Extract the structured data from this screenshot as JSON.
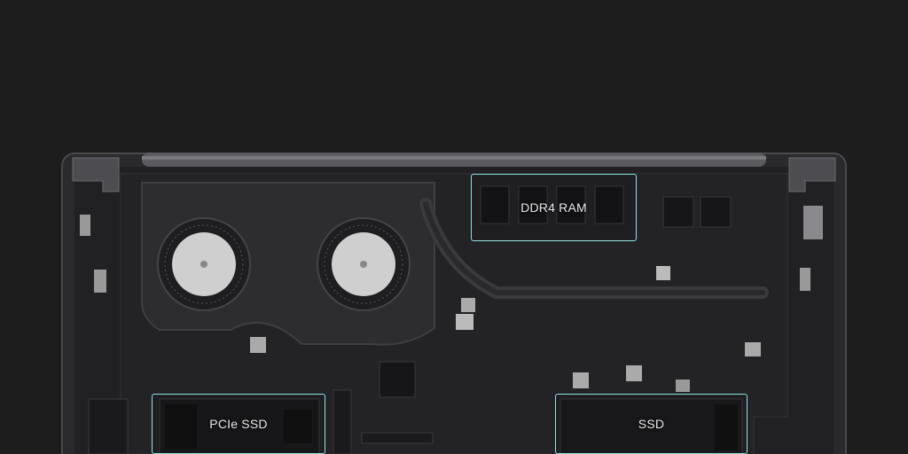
{
  "callouts": [
    {
      "label": "DDR4 RAM"
    },
    {
      "label": "PCIe SSD"
    },
    {
      "label": "SSD"
    }
  ],
  "colors": {
    "background": "#1d1d1d",
    "chassis": "#2a2a2c",
    "board": "#232325",
    "heatsink": "#303033",
    "fan": "#cfcfcf",
    "highlight": "#8fe3e0"
  },
  "icons": [
    "fan-icon",
    "ram-chip-icon",
    "ssd-module-icon",
    "hinge-icon"
  ]
}
